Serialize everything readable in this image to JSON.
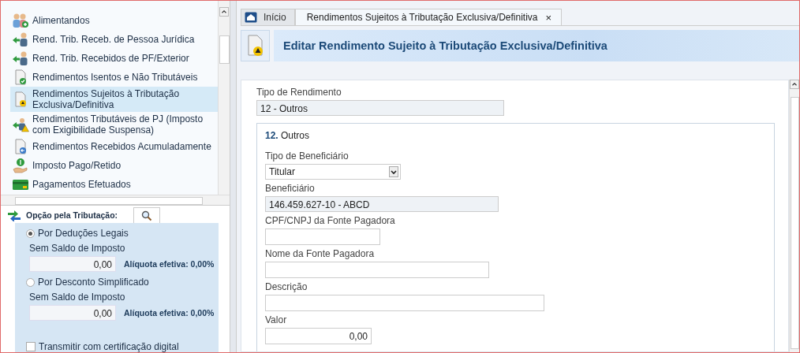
{
  "sidebar": {
    "items": [
      {
        "label": "Alimentandos",
        "kind": "people",
        "selected": false
      },
      {
        "label": "Rend. Trib. Receb. de Pessoa Jurídica",
        "kind": "transfer",
        "selected": false
      },
      {
        "label": "Rend. Trib. Recebidos de PF/Exterior",
        "kind": "transfer",
        "selected": false
      },
      {
        "label": "Rendimentos Isentos e Não Tributáveis",
        "kind": "exempt",
        "selected": false
      },
      {
        "label": "Rendimentos Sujeitos à Tributação Exclusiva/Definitiva",
        "kind": "warning",
        "selected": true
      },
      {
        "label": "Rendimentos Tributáveis de PJ (Imposto com Exigibilidade Suspensa)",
        "kind": "suspended",
        "selected": false
      },
      {
        "label": "Rendimentos Recebidos Acumuladamente",
        "kind": "accumulated",
        "selected": false
      },
      {
        "label": "Imposto Pago/Retido",
        "kind": "tax",
        "selected": false
      },
      {
        "label": "Pagamentos Efetuados",
        "kind": "payment",
        "selected": false
      }
    ]
  },
  "tax_option": {
    "title": "Opção pela Tributação:",
    "options": [
      {
        "label": "Por Deduções Legais",
        "selected": true,
        "sublabel": "Sem Saldo de Imposto",
        "value": "0,00",
        "rate": "Alíquota efetiva: 0,00%"
      },
      {
        "label": "Por Desconto Simplificado",
        "selected": false,
        "sublabel": "Sem Saldo de Imposto",
        "value": "0,00",
        "rate": "Alíquota efetiva: 0,00%"
      }
    ],
    "certification": {
      "label": "Transmitir com certificação digital",
      "checked": false
    }
  },
  "tabs": [
    {
      "label": "Início",
      "selected": false
    },
    {
      "label": "Rendimentos Sujeitos à Tributação Exclusiva/Definitiva",
      "selected": true,
      "close": "×"
    }
  ],
  "header": {
    "title": "Editar Rendimento Sujeito à Tributação Exclusiva/Definitiva"
  },
  "form": {
    "income_type": {
      "label": "Tipo de Rendimento",
      "value": "12 - Outros"
    },
    "section": {
      "number": "12.",
      "title": "Outros"
    },
    "fields": [
      {
        "kind": "select",
        "label": "Tipo de Beneficiário",
        "value": "Titular"
      },
      {
        "kind": "readonly",
        "label": "Beneficiário",
        "value": "146.459.627-10 - ABCD"
      },
      {
        "kind": "text",
        "label": "CPF/CNPJ da Fonte Pagadora"
      },
      {
        "kind": "text",
        "label": "Nome da Fonte Pagadora"
      },
      {
        "kind": "text",
        "label": "Descrição"
      },
      {
        "kind": "number",
        "label": "Valor",
        "value": "0,00"
      }
    ]
  }
}
